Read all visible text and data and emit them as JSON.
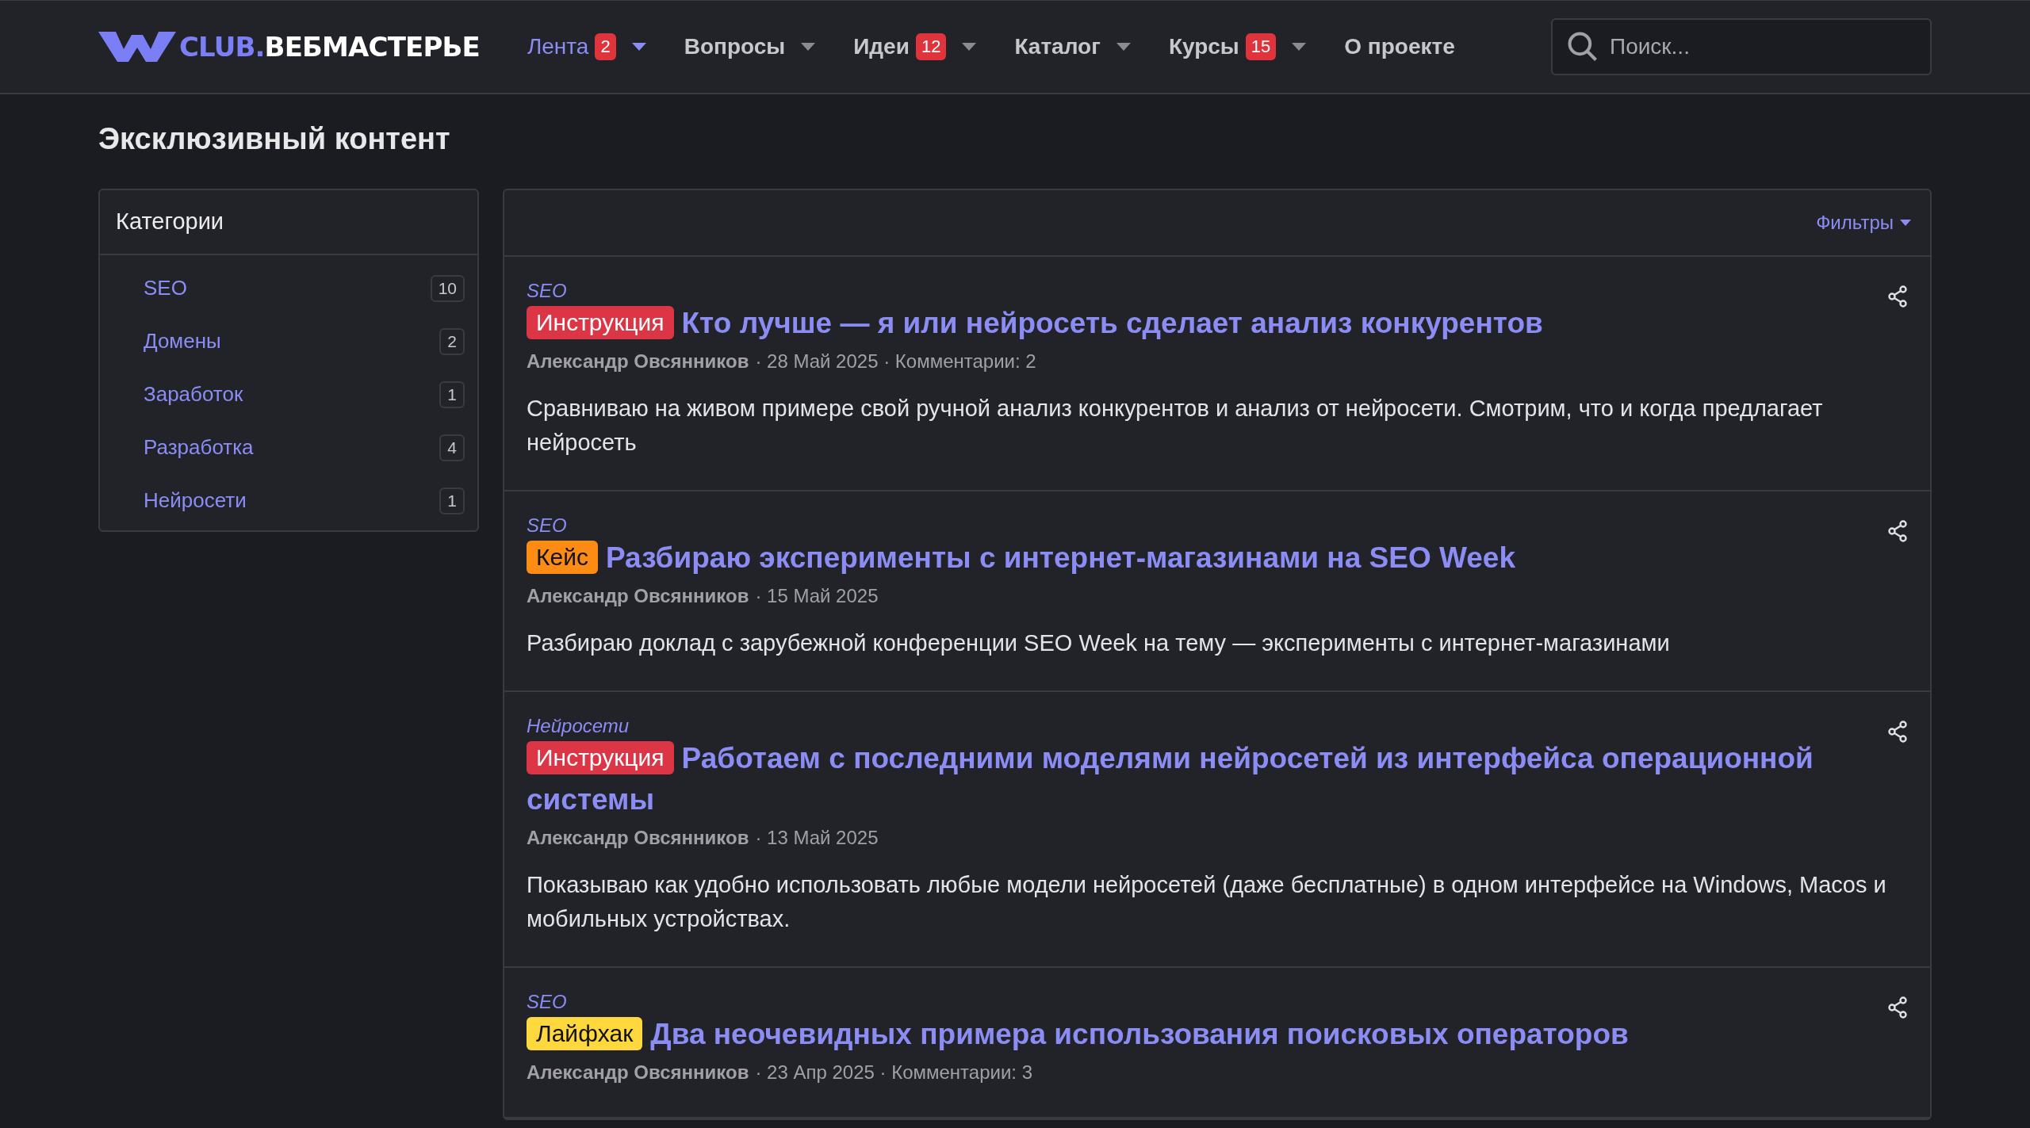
{
  "header": {
    "logo": {
      "prefix": "CLUB.",
      "name": "ВЕБМАСТЕРЬЕ"
    },
    "nav": [
      {
        "label": "Лента",
        "selected": true,
        "count": "2",
        "dropdown": true
      },
      {
        "label": "Вопросы",
        "selected": false,
        "dropdown": true
      },
      {
        "label": "Идеи",
        "selected": false,
        "count": "12",
        "dropdown": true
      },
      {
        "label": "Каталог",
        "selected": false,
        "dropdown": true
      },
      {
        "label": "Курсы",
        "selected": false,
        "count": "15",
        "dropdown": true
      },
      {
        "label": "О проекте",
        "selected": false,
        "dropdown": false
      }
    ],
    "search": {
      "placeholder": "Поиск..."
    }
  },
  "page_title": "Эксклюзивный контент",
  "sidebar": {
    "title": "Категории",
    "items": [
      {
        "label": "SEO",
        "count": "10"
      },
      {
        "label": "Домены",
        "count": "2"
      },
      {
        "label": "Заработок",
        "count": "1"
      },
      {
        "label": "Разработка",
        "count": "4"
      },
      {
        "label": "Нейросети",
        "count": "1"
      }
    ]
  },
  "filters_button": "Фильтры",
  "posts": [
    {
      "category": "SEO",
      "badge": {
        "text": "Инструкция",
        "color": "#dc3545"
      },
      "title": "Кто лучше — я или нейросеть сделает анализ конкурентов",
      "author": "Александр Овсянников",
      "meta": "· 28 Май 2025 · Комментарии: 2",
      "excerpt": "Сравниваю на живом примере свой ручной анализ конкурентов и анализ от нейросети. Смотрим, что и когда предлагает нейросеть"
    },
    {
      "category": "SEO",
      "badge": {
        "text": "Кейс",
        "color": "#fd8c14"
      },
      "title": "Разбираю эксперименты с интернет-магазинами на SEO Week",
      "author": "Александр Овсянников",
      "meta": "· 15 Май 2025",
      "excerpt": "Разбираю доклад с зарубежной конференции SEO Week на тему — эксперименты с интернет-магазинами"
    },
    {
      "category": "Нейросети",
      "badge": {
        "text": "Инструкция",
        "color": "#dc3545"
      },
      "title": "Работаем с последними моделями нейросетей из интерфейса операционной системы",
      "author": "Александр Овсянников",
      "meta": "· 13 Май 2025",
      "excerpt": "Показываю как удобно использовать любые модели нейросетей (даже бесплатные) в одном интерфейсе на Windows, Macos и мобильных устройствах."
    },
    {
      "category": "SEO",
      "badge": {
        "text": "Лайфхак",
        "color": "#ffd83d"
      },
      "title": "Два неочевидных примера использования поисковых операторов",
      "author": "Александр Овсянников",
      "meta": "· 23 Апр 2025 · Комментарии: 3"
    }
  ]
}
